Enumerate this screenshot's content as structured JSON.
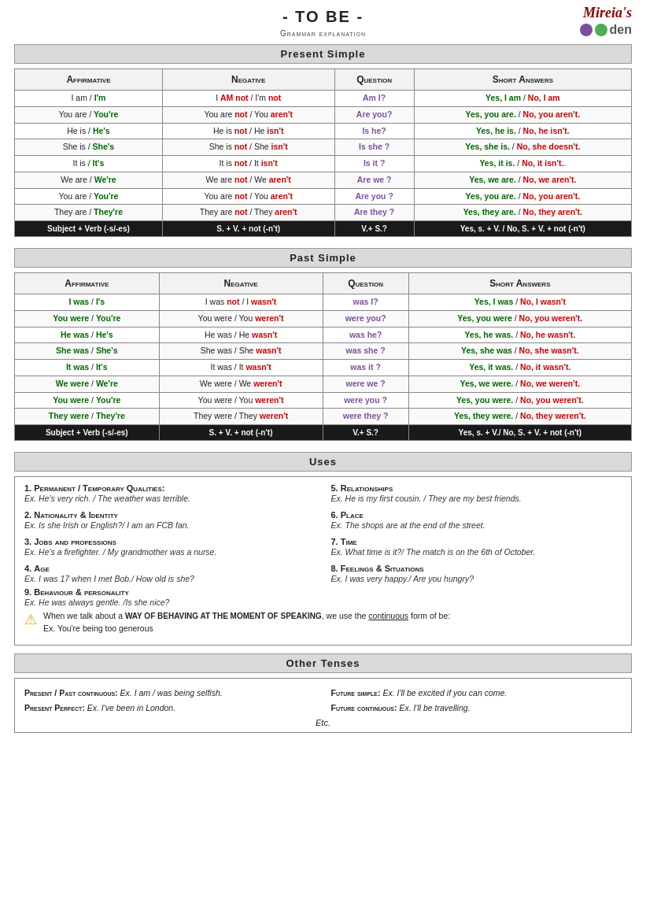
{
  "header": {
    "title": "- TO BE -",
    "subtitle": "Grammar explanation",
    "logo_text": "Mireia's",
    "logo_den": "den"
  },
  "present_simple": {
    "section_label": "Present Simple",
    "columns": [
      "Affirmative",
      "Negative",
      "Question",
      "Short Answers"
    ],
    "rows": [
      {
        "aff": "I am / I'm",
        "neg": "I AM not / I'm not",
        "q": "Am I?",
        "sa": "Yes, I am / No, I am"
      },
      {
        "aff": "You are / You're",
        "neg": "You are not / You aren't",
        "q": "Are you?",
        "sa": "Yes, you are. / No, you aren't."
      },
      {
        "aff": "He is / He's",
        "neg": "He is not / He isn't",
        "q": "Is he?",
        "sa": "Yes, he is. / No, he isn't."
      },
      {
        "aff": "She is / She's",
        "neg": "She is not / She isn't",
        "q": "Is she ?",
        "sa": "Yes, she is. / No, she doesn't."
      },
      {
        "aff": "It is / It's",
        "neg": "It is not / It isn't",
        "q": "Is it ?",
        "sa": "Yes, it is. / No, it isn't.."
      },
      {
        "aff": "We are / We're",
        "neg": "We are not / We aren't",
        "q": "Are we ?",
        "sa": "Yes, we are. / No, we aren't."
      },
      {
        "aff": "You are / You're",
        "neg": "You are not / You aren't",
        "q": "Are you ?",
        "sa": "Yes, you are. / No, you aren't."
      },
      {
        "aff": "They are / They're",
        "neg": "They are not / They aren't",
        "q": "Are they ?",
        "sa": "Yes, they are. / No, they aren't."
      },
      {
        "aff": "Subject + Verb (-s/-es)",
        "neg": "S. + V. + not (-n't)",
        "q": "V.+ S.?",
        "sa": "Yes, s. + V. / No, S. + V. + not (-n't)"
      }
    ]
  },
  "past_simple": {
    "section_label": "Past Simple",
    "columns": [
      "Affirmative",
      "Negative",
      "Question",
      "Short Answers"
    ],
    "rows": [
      {
        "aff": "I was / I's",
        "neg": "I was not / I wasn't",
        "q": "was I?",
        "sa": "Yes, I was / No, I wasn't"
      },
      {
        "aff": "You were / You're",
        "neg": "You were / You weren't",
        "q": "were you?",
        "sa": "Yes, you were / No, you weren't."
      },
      {
        "aff": "He was / He's",
        "neg": "He was / He wasn't",
        "q": "was he?",
        "sa": "Yes, he was. / No, he wasn't."
      },
      {
        "aff": "She was / She's",
        "neg": "She was / She wasn't",
        "q": "was she ?",
        "sa": "Yes, she was / No, she wasn't."
      },
      {
        "aff": "It was / It's",
        "neg": "It was / It wasn't",
        "q": "was it ?",
        "sa": "Yes, it was. / No, it wasn't."
      },
      {
        "aff": "We were / We're",
        "neg": "We were / We weren't",
        "q": "were we ?",
        "sa": "Yes, we were. / No, we weren't."
      },
      {
        "aff": "You were / You're",
        "neg": "You were / You weren't",
        "q": "were you ?",
        "sa": "Yes, you were. / No, you weren't."
      },
      {
        "aff": "They were / They're",
        "neg": "They were / They weren't",
        "q": "were they ?",
        "sa": "Yes, they were. / No, they weren't."
      },
      {
        "aff": "Subject + Verb (-s/-es)",
        "neg": "S. + V. + not (-n't)",
        "q": "V.+ S.?",
        "sa": "Yes, s. + V./ No, S. + V. + not (-n't)"
      }
    ]
  },
  "uses": {
    "section_label": "Uses",
    "items": [
      {
        "number": "1.",
        "title": "Permanent / Temporary Qualities:",
        "example": "Ex. He's very rich. / The weather was terrible."
      },
      {
        "number": "5.",
        "title": "Relationships",
        "example": "Ex. He is my first cousin. / They are my best friends."
      },
      {
        "number": "2.",
        "title": "Nationality & Identity",
        "example": "Ex. Is she Irish or English?/ I am an FCB fan."
      },
      {
        "number": "6.",
        "title": "Place",
        "example": "Ex. The shops are at the end of the street."
      },
      {
        "number": "3.",
        "title": "Jobs and professions",
        "example": "Ex. He's a firefighter. / My grandmother was a nurse."
      },
      {
        "number": "7.",
        "title": "Time",
        "example": "Ex. What time is it?/ The match is on the 6th of October."
      },
      {
        "number": "4.",
        "title": "Age",
        "example": "Ex. I was 17 when I met Bob./ How old is she?"
      },
      {
        "number": "8.",
        "title": "Feelings & Situations",
        "example": "Ex. I was very happy./ Are you hungry?"
      }
    ],
    "item9_number": "9.",
    "item9_title": "Behaviour & personality",
    "item9_example": "Ex. He was always gentle. /Is she nice?",
    "warning_text1": "When we talk about a ",
    "warning_bold": "way of behaving at the moment of speaking",
    "warning_text2": ", we use the ",
    "warning_underline": "continuous",
    "warning_text3": " form of be:",
    "warning_example": "Ex. You're being too generous"
  },
  "other_tenses": {
    "section_label": "Other Tenses",
    "items_left": [
      {
        "label": "Present / Past continuous:",
        "text": "Ex. I am / was being selfish."
      },
      {
        "label": "Present Perfect:",
        "text": "Ex. I've been in London."
      }
    ],
    "items_right": [
      {
        "label": "Future simple:",
        "text": "Ex. I'll be excited if you can come."
      },
      {
        "label": "Future continuous:",
        "text": "Ex. I'll be travelling."
      }
    ],
    "etc": "Etc."
  }
}
